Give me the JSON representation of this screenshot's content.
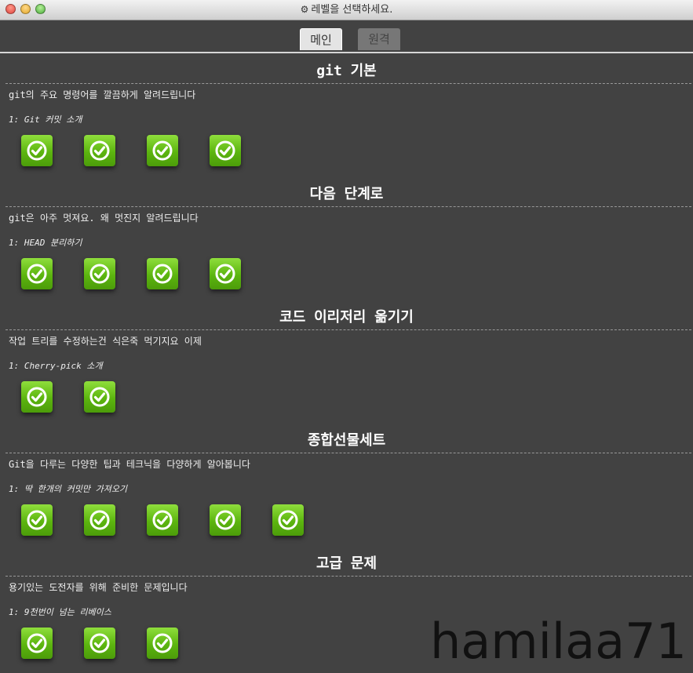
{
  "window": {
    "title": "레벨을 선택하세요.",
    "title_icon": "gear-icon"
  },
  "tabs": [
    {
      "label": "메인",
      "active": true
    },
    {
      "label": "원격",
      "active": false
    }
  ],
  "sections": [
    {
      "title": "git 기본",
      "description": "git의 주요 명령어를 깔끔하게 알려드립니다",
      "level_label": "1: Git 커밋 소개",
      "levels_total": 4,
      "levels_completed": 4
    },
    {
      "title": "다음 단계로",
      "description": "git은 아주 멋져요. 왜 멋진지 알려드립니다",
      "level_label": "1: HEAD 분리하기",
      "levels_total": 4,
      "levels_completed": 4
    },
    {
      "title": "코드 이리저리 옮기기",
      "description": "작업 트리를 수정하는건 식은죽 먹기지요 이제",
      "level_label": "1: Cherry-pick 소개",
      "levels_total": 2,
      "levels_completed": 2
    },
    {
      "title": "종합선물세트",
      "description": "Git을 다루는 다양한 팁과 테크닉을 다양하게 알아봅니다",
      "level_label": "1: 딱 한개의 커밋만 가져오기",
      "levels_total": 5,
      "levels_completed": 5
    },
    {
      "title": "고급 문제",
      "description": "용기있는 도전자를 위해 준비한 문제입니다",
      "level_label": "1: 9천번이 넘는 리베이스",
      "levels_total": 3,
      "levels_completed": 3
    }
  ],
  "watermark": "hamilaa71",
  "colors": {
    "background": "#424242",
    "level_green": "#6cc41a",
    "tab_active": "#e4e4e4",
    "tab_inactive": "#777777"
  }
}
